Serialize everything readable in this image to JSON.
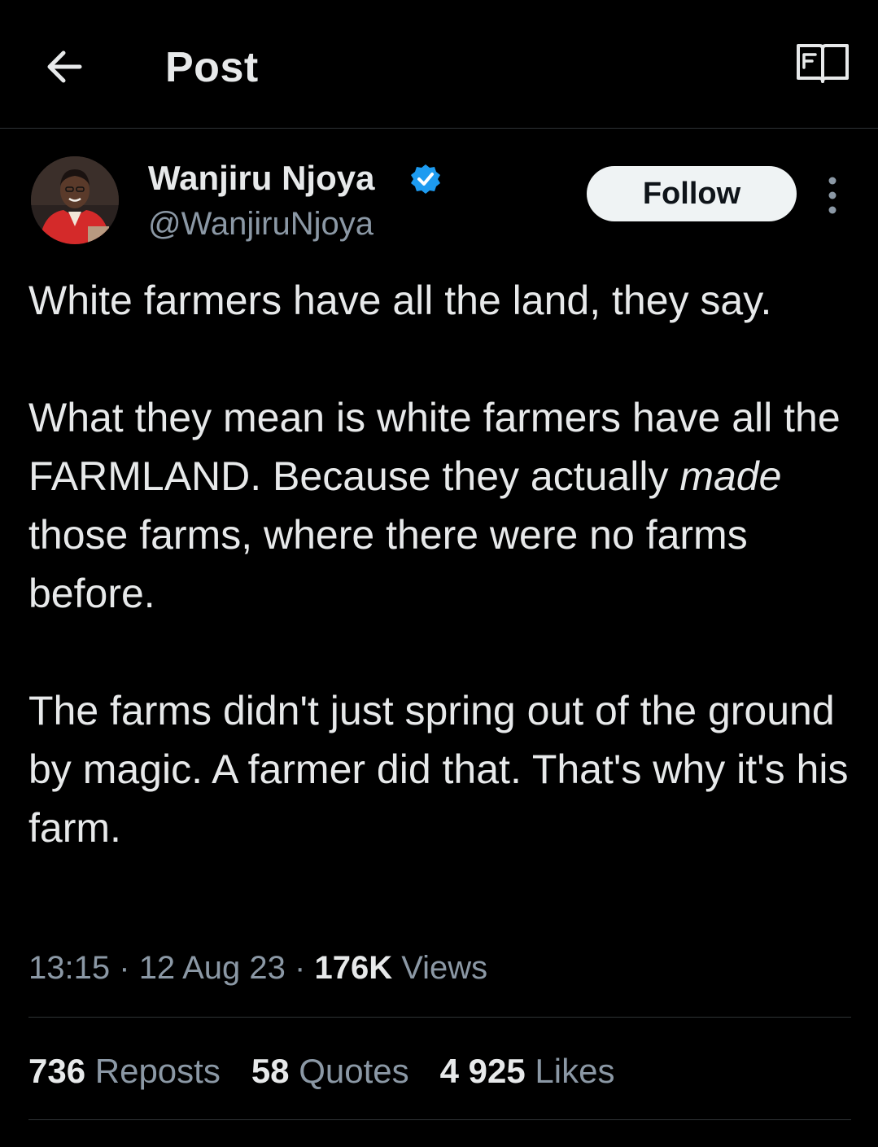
{
  "header": {
    "title": "Post",
    "back_icon": "arrow-left-icon",
    "reader_icon": "book-open-icon"
  },
  "author": {
    "display_name": "Wanjiru Njoya",
    "handle": "@WanjiruNjoya",
    "verified": true,
    "follow_label": "Follow",
    "more_icon": "more-vertical-icon"
  },
  "tweet": {
    "paragraphs": [
      {
        "text": "White farmers have all the land, they say."
      },
      {
        "before": "What they mean is white farmers have all the FARMLAND. Because they actually ",
        "emphasis": "made",
        "after": " those farms, where there were no farms before."
      },
      {
        "text": "The farms didn't just spring out of the ground by magic. A farmer did that. That's why it's his farm."
      }
    ]
  },
  "meta": {
    "time": "13:15",
    "separator": "·",
    "date": "12 Aug 23",
    "views_count": "176K",
    "views_label": "Views"
  },
  "stats": {
    "reposts_count": "736",
    "reposts_label": "Reposts",
    "quotes_count": "58",
    "quotes_label": "Quotes",
    "likes_count": "4 925",
    "likes_label": "Likes"
  },
  "colors": {
    "background": "#000000",
    "text": "#e7e9ea",
    "muted": "#8b98a5",
    "divider": "#2f3336",
    "verified": "#1d9bf0",
    "follow_bg": "#eff3f4"
  }
}
